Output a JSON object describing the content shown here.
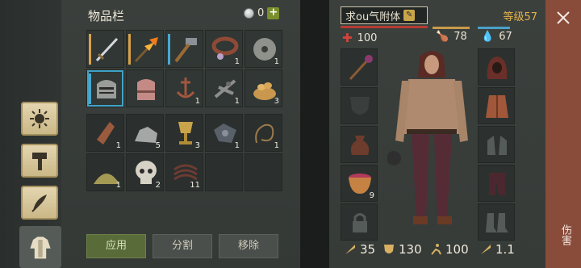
{
  "inventory": {
    "title": "物品栏",
    "currency": {
      "count": "0",
      "add_label": "+"
    },
    "top_items": [
      {
        "name": "sword",
        "qty": "",
        "bar": "gold",
        "selected": false
      },
      {
        "name": "flame-spear",
        "qty": "",
        "bar": "gold",
        "selected": false
      },
      {
        "name": "hammer",
        "qty": "",
        "bar": "blue",
        "selected": false
      },
      {
        "name": "leather-collar",
        "qty": "1",
        "bar": "",
        "selected": false
      },
      {
        "name": "grindstone",
        "qty": "1",
        "bar": "",
        "selected": false
      },
      {
        "name": "knight-helmet",
        "qty": "",
        "bar": "blue",
        "selected": true
      },
      {
        "name": "leather-helmet",
        "qty": "",
        "bar": "",
        "selected": false
      },
      {
        "name": "anchor-parts",
        "qty": "1",
        "bar": "",
        "selected": false
      },
      {
        "name": "crossbow-parts",
        "qty": "1",
        "bar": "",
        "selected": false
      },
      {
        "name": "seeds-pile",
        "qty": "3",
        "bar": "",
        "selected": false
      }
    ],
    "bottom_items": [
      {
        "name": "bottle",
        "qty": "1"
      },
      {
        "name": "rocks",
        "qty": "5"
      },
      {
        "name": "golden-goblet",
        "qty": "3"
      },
      {
        "name": "metal-scrap",
        "qty": "1"
      },
      {
        "name": "rope",
        "qty": "1"
      },
      {
        "name": "sand-pile",
        "qty": "1"
      },
      {
        "name": "skull",
        "qty": "2"
      },
      {
        "name": "worms",
        "qty": "11"
      },
      {
        "name": "",
        "qty": ""
      },
      {
        "name": "",
        "qty": ""
      }
    ],
    "buttons": {
      "apply": "应用",
      "split": "分割",
      "remove": "移除"
    }
  },
  "character": {
    "name": "求ou气附体",
    "level_label": "等级57",
    "health": "100",
    "food": "78",
    "water": "67",
    "stats": {
      "attack": "35",
      "defense": "130",
      "speed": "100",
      "weight": "1.1"
    },
    "slots_left": [
      "mace",
      "shield",
      "sack",
      "wine-bowl",
      "locked"
    ],
    "slots_left_qty": [
      "",
      "",
      "",
      "9",
      ""
    ],
    "slots_right": [
      "hood",
      "padded-jacket",
      "gloves",
      "pants",
      "boots"
    ]
  },
  "side": {
    "vertical_text": "伤害"
  },
  "colors": {
    "accent_gold": "#e2b24c",
    "health_red": "#b53a34",
    "select_blue": "#3fa3c8",
    "close_strip": "#8a4c3a"
  }
}
